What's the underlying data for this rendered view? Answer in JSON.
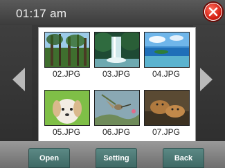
{
  "header": {
    "time": "01:17 am"
  },
  "icons": {
    "close": "close-icon",
    "prev": "arrow-left-icon",
    "next": "arrow-right-icon"
  },
  "gallery": {
    "items": [
      {
        "label": "02.JPG"
      },
      {
        "label": "03.JPG"
      },
      {
        "label": "04.JPG"
      },
      {
        "label": "05.JPG"
      },
      {
        "label": "06.JPG"
      },
      {
        "label": "07.JPG"
      }
    ]
  },
  "buttons": {
    "open": "Open",
    "setting": "Setting",
    "back": "Back"
  }
}
